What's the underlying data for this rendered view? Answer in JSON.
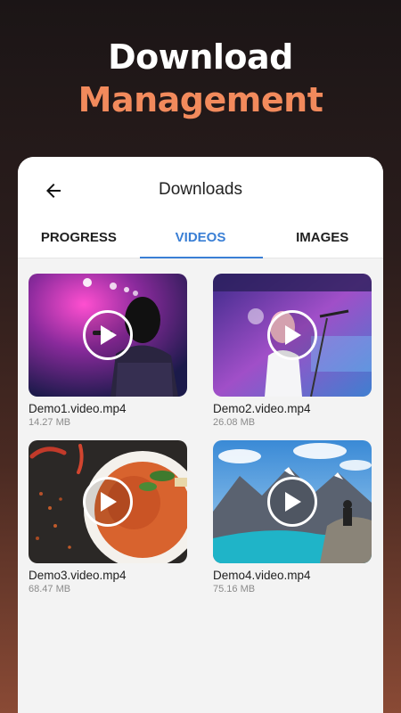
{
  "promo": {
    "title_line1": "Download",
    "title_line2": "Management",
    "accent_color": "#f28a5c"
  },
  "appbar": {
    "back_icon": "arrow-left-icon",
    "title": "Downloads"
  },
  "tabs": [
    {
      "label": "PROGRESS",
      "active": false
    },
    {
      "label": "VIDEOS",
      "active": true
    },
    {
      "label": "IMAGES",
      "active": false
    }
  ],
  "videos": [
    {
      "name": "Demo1.video.mp4",
      "size": "14.27 MB",
      "thumb": "singer-pink-stage"
    },
    {
      "name": "Demo2.video.mp4",
      "size": "26.08 MB",
      "thumb": "singer-purple-stage"
    },
    {
      "name": "Demo3.video.mp4",
      "size": "68.47 MB",
      "thumb": "curry-bowl"
    },
    {
      "name": "Demo4.video.mp4",
      "size": "75.16 MB",
      "thumb": "mountain-lake"
    }
  ],
  "colors": {
    "tab_active": "#3a7fd5",
    "text_primary": "#1f1f1f",
    "text_secondary": "#8a8a8a"
  }
}
